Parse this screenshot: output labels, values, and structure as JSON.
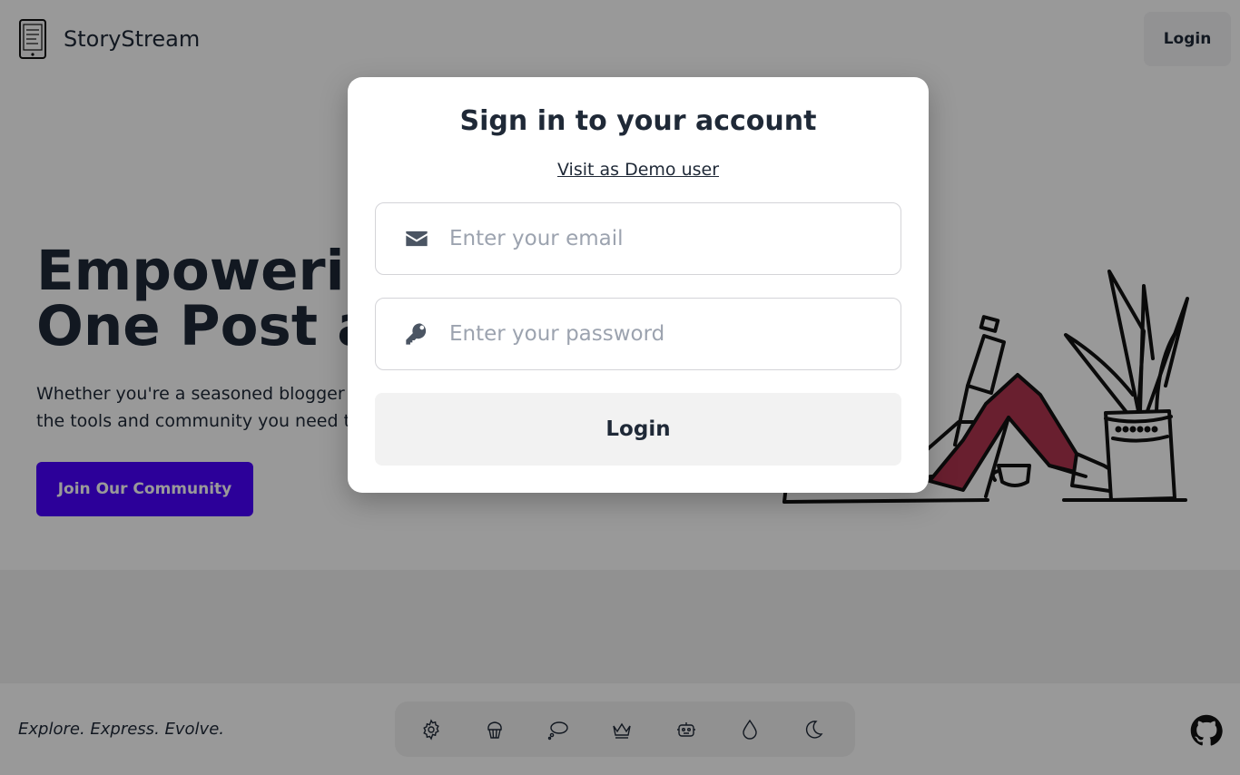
{
  "header": {
    "brand": "StoryStream",
    "login_label": "Login"
  },
  "hero": {
    "title_line1": "Empowering Voices,",
    "title_line2": "One Post at a Time",
    "subtitle_line1": "Whether you're a seasoned blogger or just starting out, StoryStream gives you",
    "subtitle_line2": "the tools and community you need to share your stories.",
    "cta_label": "Join Our Community"
  },
  "footer": {
    "tagline": "Explore. Express. Evolve.",
    "themes": [
      "gear-icon",
      "cupcake-icon",
      "thought-bubble-icon",
      "crown-icon",
      "robot-icon",
      "droplet-icon",
      "moon-icon"
    ]
  },
  "modal": {
    "title": "Sign in to your account",
    "demo_link": "Visit as Demo user",
    "email_placeholder": "Enter your email",
    "password_placeholder": "Enter your password",
    "login_label": "Login"
  },
  "colors": {
    "accent": "#4a00ff",
    "text": "#1f2937",
    "placeholder": "#9ca3af",
    "pants": "#b0344f"
  }
}
